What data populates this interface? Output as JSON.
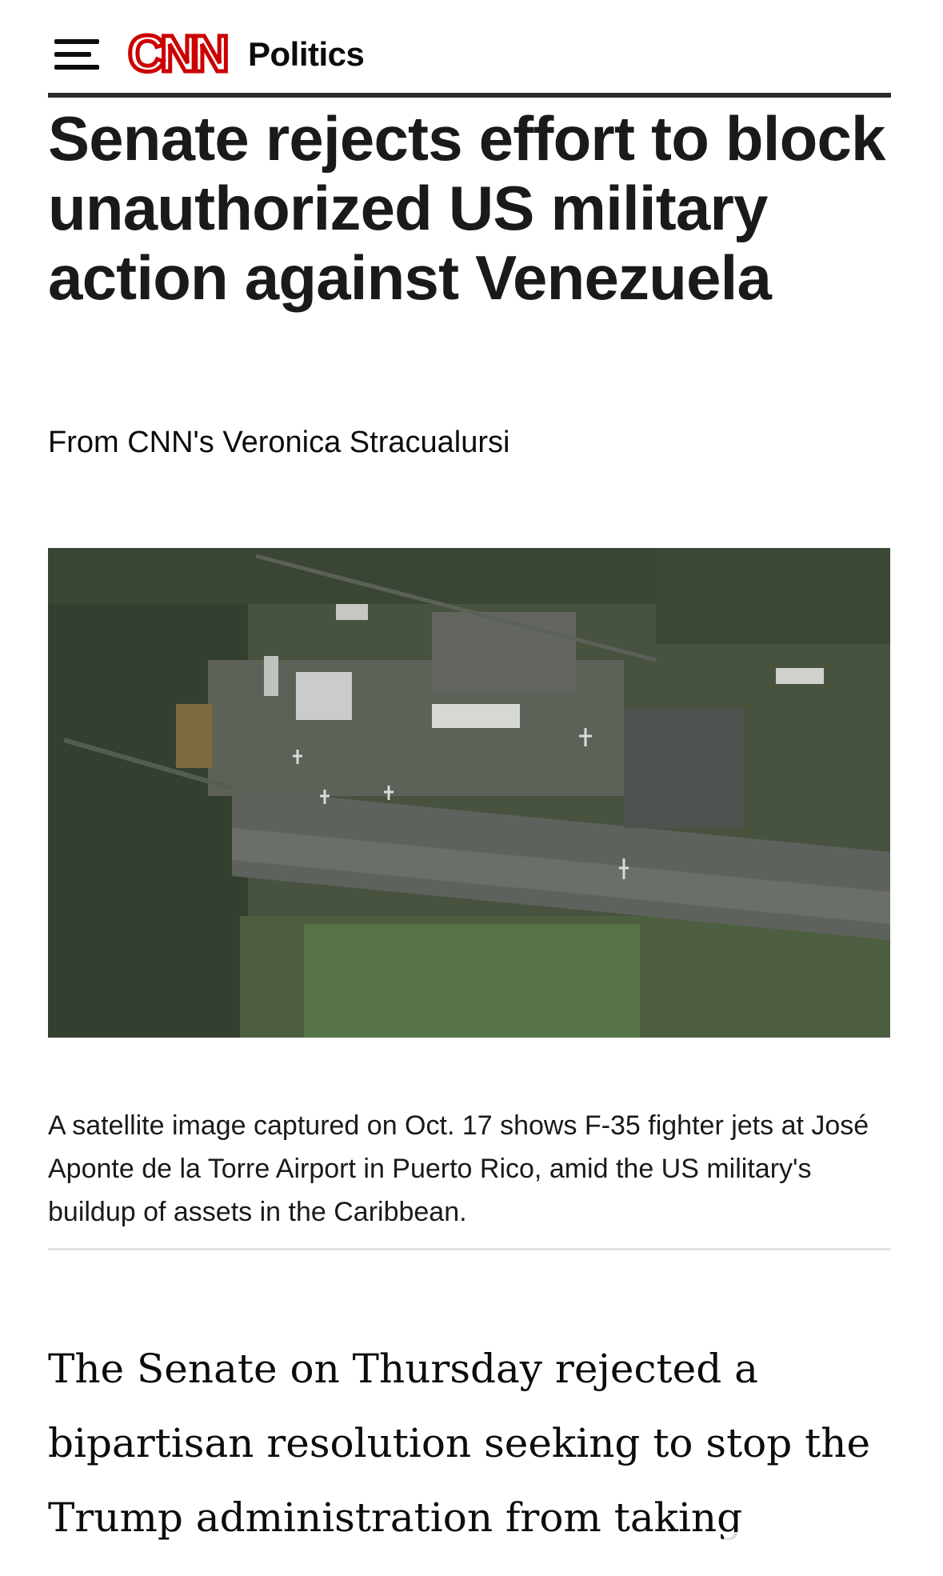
{
  "header": {
    "menu_icon": "hamburger-menu-icon",
    "logo_text": "CNN",
    "section": "Politics"
  },
  "article": {
    "headline": "Senate rejects effort to block unauthorized US military action against Venezuela",
    "byline": "From CNN's Veronica Stracualursi",
    "image": {
      "description_icon": "satellite-airport-image",
      "caption": "A satellite image captured on Oct. 17 shows F-35 fighter jets at José Aponte de la Torre Airport in Puerto Rico, amid the US military's buildup of assets in the Caribbean."
    },
    "body_first_paragraph": "The Senate on Thursday rejected a bipartisan resolution seeking to stop the Trump administration from taking"
  },
  "colors": {
    "brand_red": "#cc0000",
    "text": "#0c0c0c",
    "rule": "#2b2b2b"
  }
}
